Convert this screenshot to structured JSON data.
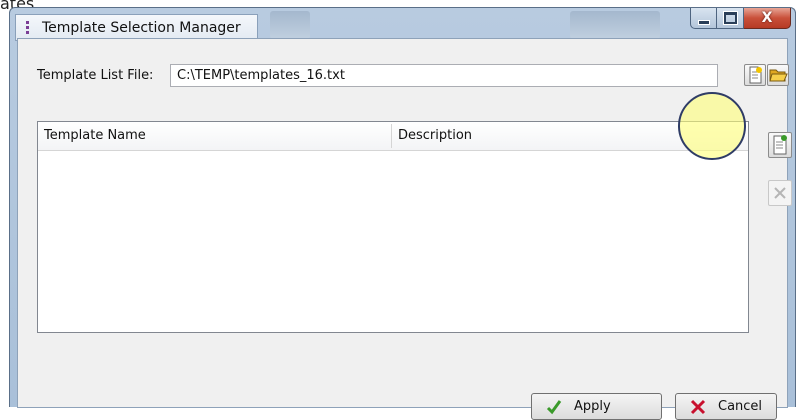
{
  "background_text": "ates",
  "window": {
    "title": "Template Selection Manager",
    "close_glyph": "X"
  },
  "file_row": {
    "label": "Template List File:",
    "value": "C:\\TEMP\\templates_16.txt"
  },
  "grid": {
    "columns": [
      "Template Name",
      "Description"
    ],
    "rows": []
  },
  "buttons": {
    "apply": "Apply",
    "cancel": "Cancel"
  },
  "colors": {
    "title_accent": "#7b3e95",
    "highlight": "#ffff78",
    "check_green": "#3a9a2a",
    "cancel_red": "#c8102e"
  },
  "icons": [
    "app-icon",
    "minimize-icon",
    "maximize-icon",
    "close-icon",
    "new-file-icon",
    "open-folder-icon",
    "add-template-icon",
    "remove-icon",
    "check-icon",
    "x-icon"
  ]
}
